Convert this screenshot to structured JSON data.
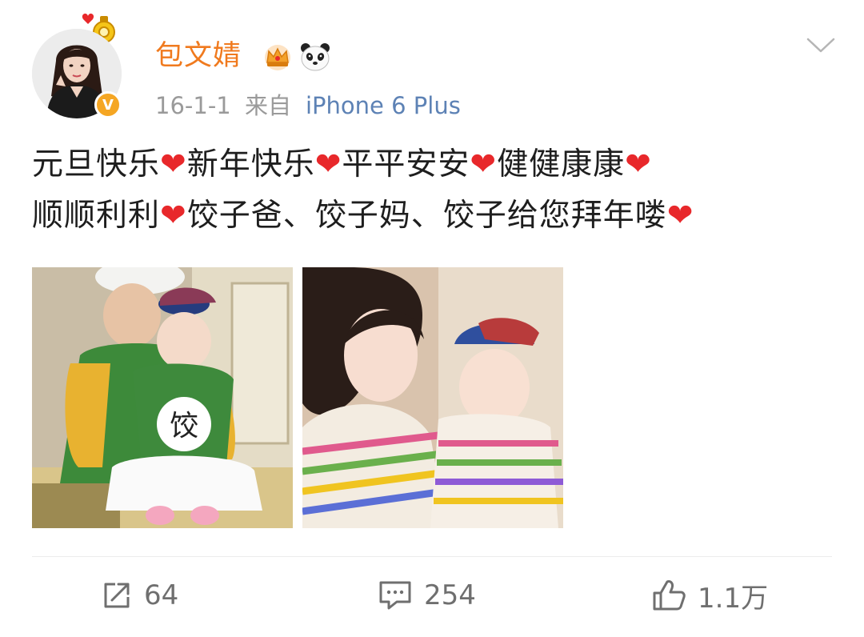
{
  "post": {
    "username": "包文婧",
    "date": "16-1-1",
    "source_prefix": "来自",
    "device": "iPhone 6 Plus",
    "text": {
      "l1_s1": "元旦快乐",
      "l1_s2": "新年快乐",
      "l1_s3": "平平安安",
      "l1_s4": "健健康康",
      "l2_s1": "顺顺利利",
      "l2_s2": "饺子爸、饺子妈、饺子给您拜年喽",
      "heart": "❤"
    },
    "verified_badge": "V",
    "photos": [
      "photo-father-and-baby",
      "photo-mother-and-baby"
    ],
    "photo_text": "饺"
  },
  "actions": {
    "share_count": "64",
    "comment_count": "254",
    "like_count": "1.1万"
  },
  "icons": {
    "crown": "crown-icon",
    "panda": "panda-emoji-icon",
    "chevron": "chevron-down-icon",
    "share": "share-icon",
    "comment": "comment-icon",
    "like": "thumbs-up-icon"
  },
  "colors": {
    "username": "#f07a1e",
    "device_link": "#5d82b5",
    "heart": "#e8282b",
    "muted_text": "#9a9a9a",
    "verified_badge": "#f5a623"
  }
}
